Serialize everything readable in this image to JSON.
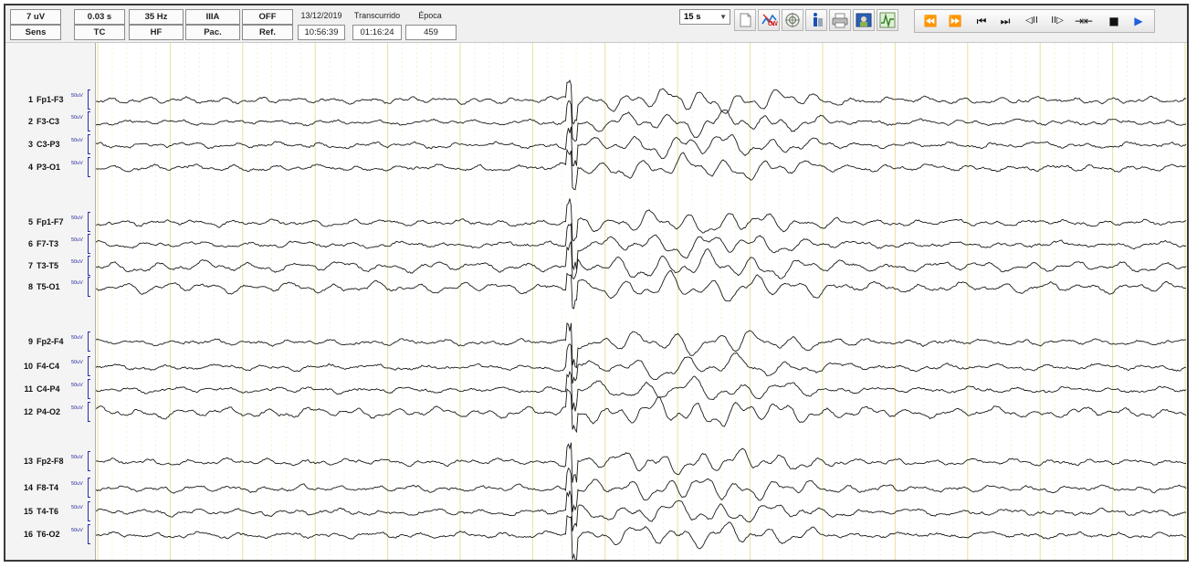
{
  "toolbar": {
    "settings": [
      {
        "value": "7 uV",
        "label": "Sens"
      },
      {
        "value": "0.03 s",
        "label": "TC"
      },
      {
        "value": "35 Hz",
        "label": "HF"
      },
      {
        "value": "IIIA",
        "label": "Pac."
      },
      {
        "value": "OFF",
        "label": "Ref."
      }
    ],
    "date": "13/12/2019",
    "time": "10:56:39",
    "elapsed_label": "Transcurrido",
    "elapsed_value": "01:16:24",
    "epoch_label": "Época",
    "epoch_value": "459",
    "timebase": "15 s",
    "icons": [
      "page-icon",
      "montage-on-icon",
      "target-icon",
      "info-icon",
      "print-icon",
      "photo-icon",
      "waveform-icon"
    ],
    "icon_badge": "ON",
    "nav": [
      "⏪",
      "⏩",
      "⏮",
      "⏭",
      "◁II",
      "II▷",
      "⇥⇤",
      "■",
      "▶"
    ]
  },
  "channels": [
    {
      "num": "1",
      "name": "Fp1-F3",
      "scale": "50uV"
    },
    {
      "num": "2",
      "name": "F3-C3",
      "scale": "50uV"
    },
    {
      "num": "3",
      "name": "C3-P3",
      "scale": "50uV"
    },
    {
      "num": "4",
      "name": "P3-O1",
      "scale": "50uV"
    },
    {
      "num": "5",
      "name": "Fp1-F7",
      "scale": "50uV"
    },
    {
      "num": "6",
      "name": "F7-T3",
      "scale": "50uV"
    },
    {
      "num": "7",
      "name": "T3-T5",
      "scale": "50uV"
    },
    {
      "num": "8",
      "name": "T5-O1",
      "scale": "50uV"
    },
    {
      "num": "9",
      "name": "Fp2-F4",
      "scale": "50uV"
    },
    {
      "num": "10",
      "name": "F4-C4",
      "scale": "50uV"
    },
    {
      "num": "11",
      "name": "C4-P4",
      "scale": "50uV"
    },
    {
      "num": "12",
      "name": "P4-O2",
      "scale": "50uV"
    },
    {
      "num": "13",
      "name": "Fp2-F8",
      "scale": "50uV"
    },
    {
      "num": "14",
      "name": "F8-T4",
      "scale": "50uV"
    },
    {
      "num": "15",
      "name": "T4-T6",
      "scale": "50uV"
    },
    {
      "num": "16",
      "name": "T6-O2",
      "scale": "50uV"
    }
  ],
  "colors": {
    "grid_major": "#e8e29a",
    "grid_minor": "#f3efc8",
    "trace": "#1a1a1a",
    "scale_bar": "#2b2bb0"
  }
}
